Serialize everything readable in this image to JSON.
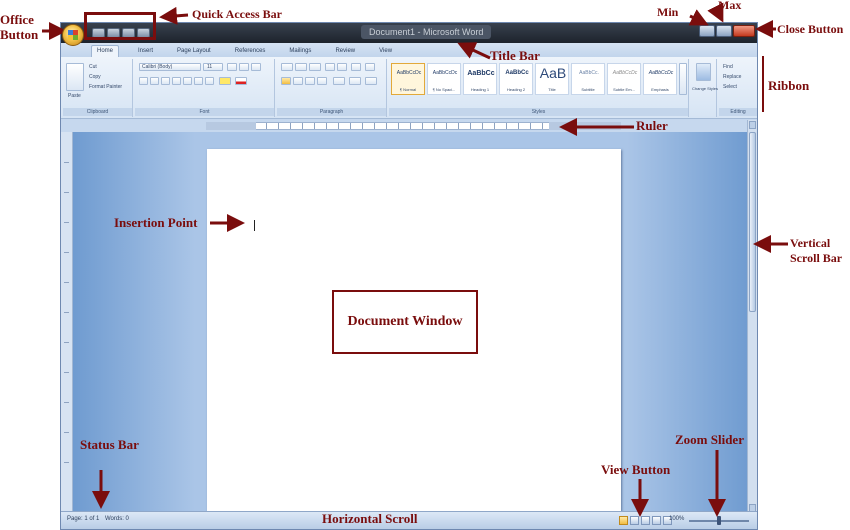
{
  "window": {
    "title": "Document1 - Microsoft Word",
    "tabs": [
      "Home",
      "Insert",
      "Page Layout",
      "References",
      "Mailings",
      "Review",
      "View"
    ]
  },
  "ribbon": {
    "clipboard": {
      "paste": "Paste",
      "cut": "Cut",
      "copy": "Copy",
      "format_painter": "Format Painter",
      "label": "Clipboard"
    },
    "font": {
      "font_name": "Calibri (Body)",
      "font_size": "11",
      "label": "Font"
    },
    "paragraph": {
      "label": "Paragraph"
    },
    "styles": {
      "label": "Styles",
      "items": [
        {
          "preview": "AaBbCcDc",
          "name": "¶ Normal"
        },
        {
          "preview": "AaBbCcDc",
          "name": "¶ No Spaci..."
        },
        {
          "preview": "AaBbCc",
          "name": "Heading 1"
        },
        {
          "preview": "AaBbCc",
          "name": "Heading 2"
        },
        {
          "preview": "AaB",
          "name": "Title"
        },
        {
          "preview": "AaBbCc.",
          "name": "Subtitle"
        },
        {
          "preview": "AaBbCcDc",
          "name": "Subtle Em..."
        },
        {
          "preview": "AaBbCcDc",
          "name": "Emphasis"
        }
      ],
      "change_styles": "Change Styles"
    },
    "editing": {
      "find": "Find",
      "replace": "Replace",
      "select": "Select",
      "label": "Editing"
    }
  },
  "statusbar": {
    "page": "Page: 1 of 1",
    "words": "Words: 0",
    "zoom": "100%"
  },
  "annotations": {
    "office_button": "Office Button",
    "quick_access_bar": "Quick Access Bar",
    "title_bar": "Title Bar",
    "min": "Min",
    "max": "Max",
    "close_button": "Close Button",
    "ribbon": "Ribbon",
    "ruler": "Ruler",
    "insertion_point": "Insertion Point",
    "vertical_scroll_bar": "Vertical Scroll Bar",
    "document_window": "Document Window",
    "status_bar": "Status Bar",
    "horizontal_scroll": "Horizontal Scroll",
    "view_button": "View Button",
    "zoom_slider": "Zoom Slider"
  },
  "colors": {
    "annotation": "#7a0d0d",
    "title_bar": "#1d232c",
    "ribbon": "#d6e4f4",
    "workspace": "#aac5e7"
  }
}
